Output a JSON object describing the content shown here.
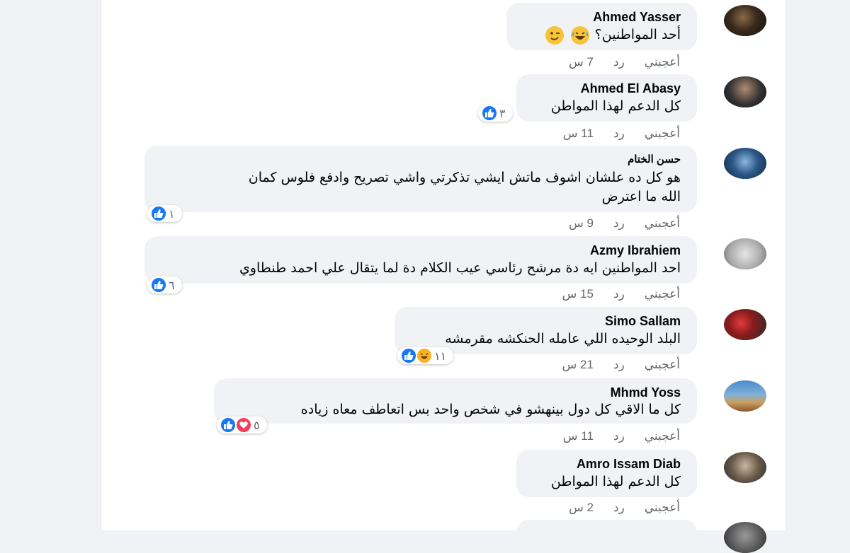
{
  "comments": [
    {
      "author": "Ahmed Yasser",
      "text": "أحد المواطنين؟",
      "emoji_icons": [
        "laughing-emoji-icon",
        "winking-emoji-icon"
      ],
      "actions": {
        "like": "أعجبني",
        "reply": "رد",
        "time": "7 س"
      },
      "reactions": null
    },
    {
      "author": "Ahmed El Abasy",
      "text": "كل الدعم لهذا المواطن",
      "actions": {
        "like": "أعجبني",
        "reply": "رد",
        "time": "11 س"
      },
      "reactions": {
        "count": "٣",
        "icons": [
          "like-icon"
        ]
      }
    },
    {
      "author": "حسن الختام",
      "text_lines": [
        "هو كل ده علشان اشوف ماتش ايشي تذكرتي واشي تصريح وادفع فلوس كمان",
        "الله ما اعترض"
      ],
      "actions": {
        "like": "أعجبني",
        "reply": "رد",
        "time": "9 س"
      },
      "reactions": {
        "count": "١",
        "icons": [
          "like-icon"
        ]
      }
    },
    {
      "author": "Azmy Ibrahiem",
      "text": "احد المواطنين ايه دة مرشح رئاسي عيب الكلام دة لما يتقال علي احمد طنطاوي",
      "actions": {
        "like": "أعجبني",
        "reply": "رد",
        "time": "15 س"
      },
      "reactions": {
        "count": "٦",
        "icons": [
          "like-icon"
        ]
      }
    },
    {
      "author": "Simo Sallam",
      "text": "البلد الوحيده اللي عامله الحنكشه مقرمشه",
      "actions": {
        "like": "أعجبني",
        "reply": "رد",
        "time": "21 س"
      },
      "reactions": {
        "count": "١١",
        "icons": [
          "like-icon",
          "haha-icon"
        ]
      }
    },
    {
      "author": "Mhmd Yoss",
      "text_lines": [
        "كل ما الاقي كل دول بينهشو في شخص واحد بس اتعاطف معاه",
        "زياده"
      ],
      "actions": {
        "like": "أعجبني",
        "reply": "رد",
        "time": "11 س"
      },
      "reactions": {
        "count": "٥",
        "icons": [
          "like-icon",
          "love-icon"
        ]
      }
    },
    {
      "author": "Amro Issam Diab",
      "text": "كل الدعم لهذا المواطن",
      "actions": {
        "like": "أعجبني",
        "reply": "رد",
        "time": "2 س"
      },
      "reactions": null
    }
  ]
}
